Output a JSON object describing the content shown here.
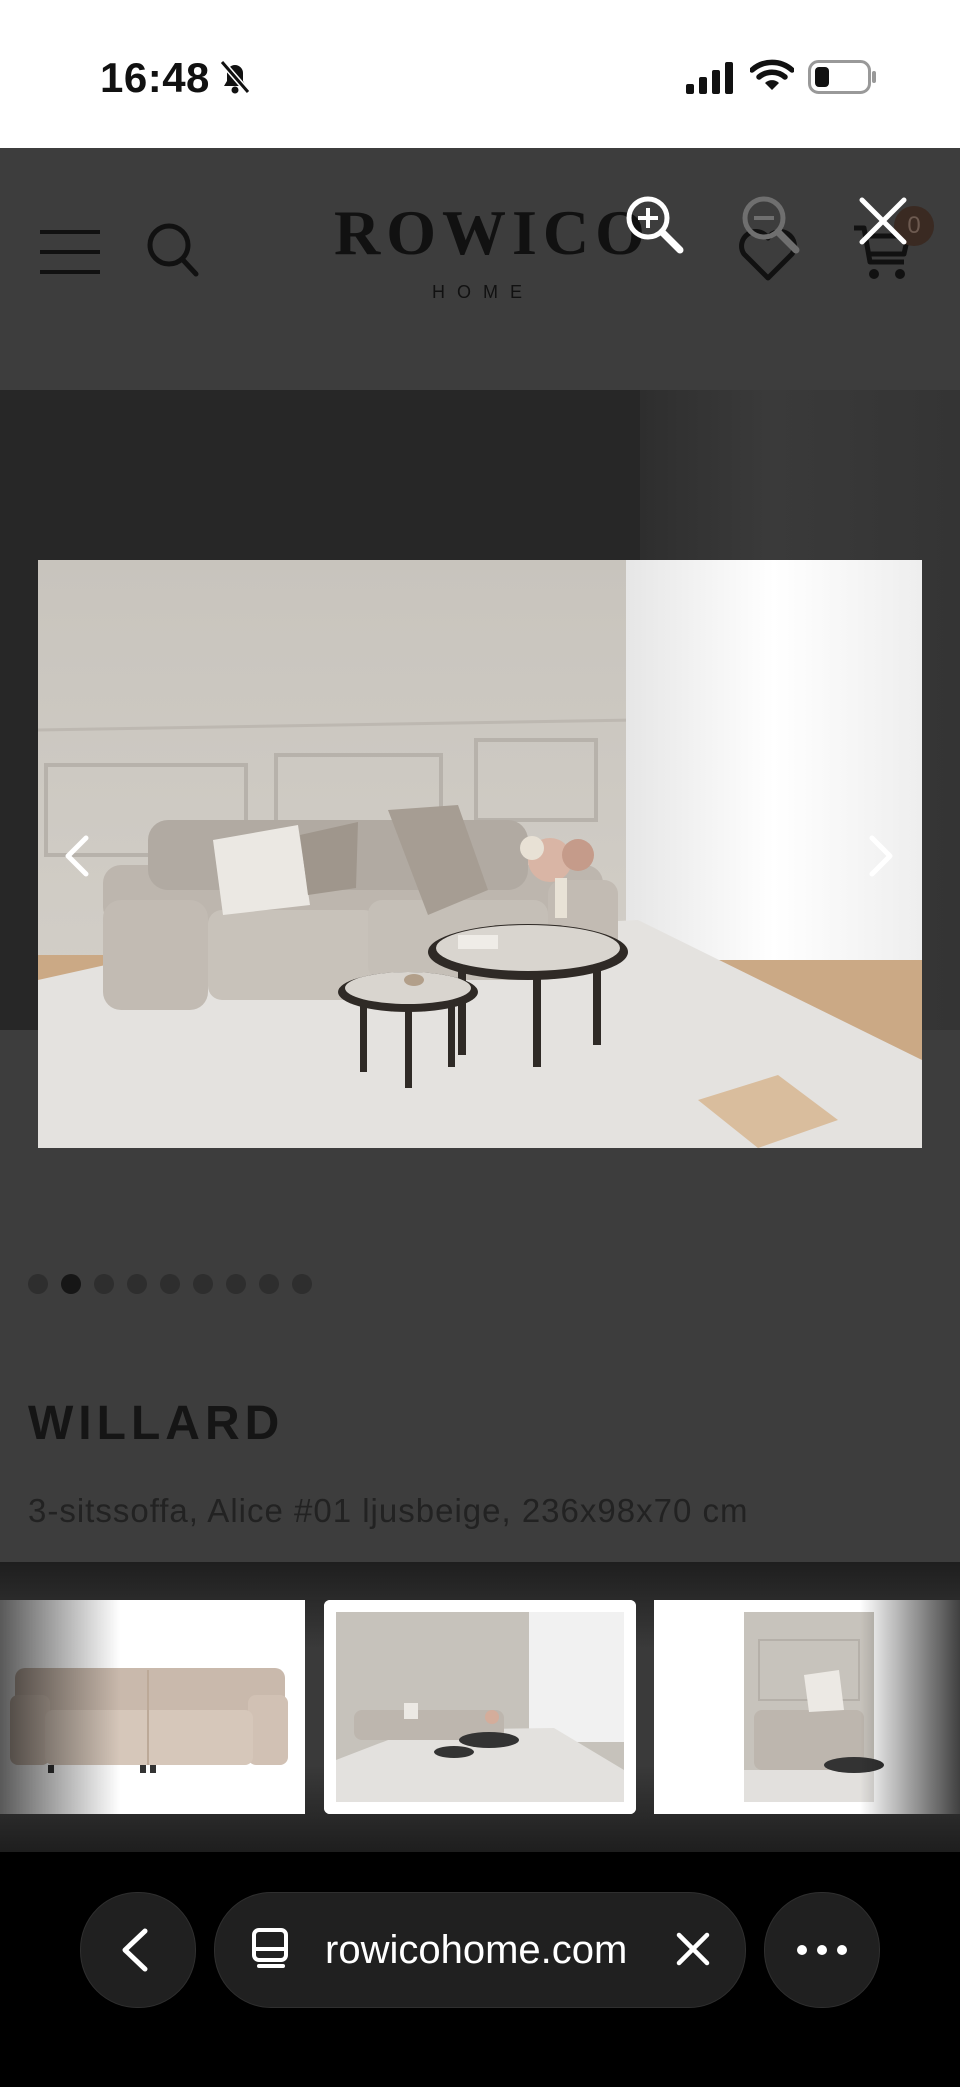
{
  "status_bar": {
    "time": "16:48"
  },
  "site": {
    "brand": "ROWICO",
    "brand_sub": "HOME",
    "cart_count": "0"
  },
  "gallery": {
    "dot_count": 9,
    "active_dot": 1
  },
  "product": {
    "title": "WILLARD",
    "subtitle": "3-sitssoffa, Alice #01 ljusbeige, 236x98x70 cm"
  },
  "browser": {
    "url": "rowicohome.com"
  },
  "icons": {
    "menu": "menu-icon",
    "search": "search-icon",
    "favorite": "heart-icon",
    "cart": "cart-icon",
    "zoom_in": "zoom-in-icon",
    "zoom_out": "zoom-out-icon",
    "close": "close-icon",
    "prev": "chevron-left-icon",
    "next": "chevron-right-icon",
    "back": "back-icon",
    "page": "page-icon",
    "more": "more-icon"
  },
  "colors": {
    "overlay": "#3d3d3d",
    "toolbar": "#000000"
  }
}
